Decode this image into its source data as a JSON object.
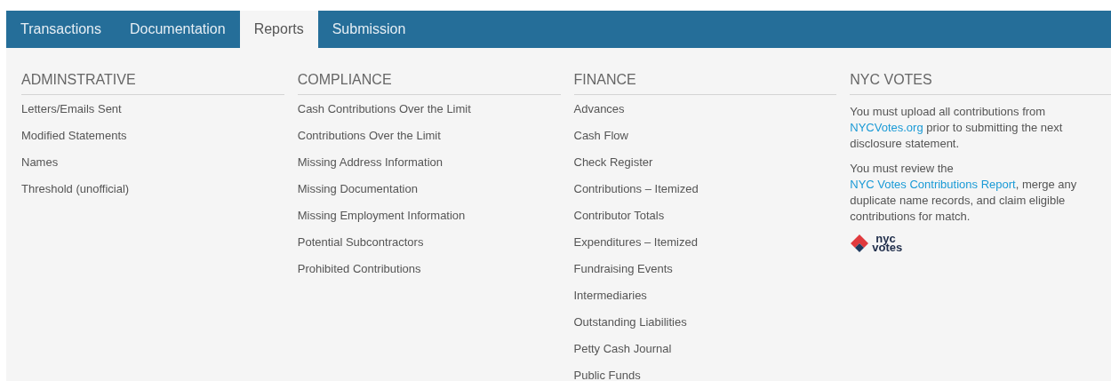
{
  "tabs": [
    {
      "label": "Transactions",
      "selected": false
    },
    {
      "label": "Documentation",
      "selected": false
    },
    {
      "label": "Reports",
      "selected": true
    },
    {
      "label": "Submission",
      "selected": false
    }
  ],
  "columns": [
    {
      "heading": "ADMINSTRATIVE",
      "items": [
        "Letters/Emails Sent",
        "Modified Statements",
        "Names",
        "Threshold (unofficial)"
      ]
    },
    {
      "heading": "COMPLIANCE",
      "items": [
        "Cash Contributions Over the Limit",
        "Contributions Over the Limit",
        "Missing Address Information",
        "Missing Documentation",
        "Missing Employment Information",
        "Potential Subcontractors",
        "Prohibited Contributions"
      ]
    },
    {
      "heading": "FINANCE",
      "items": [
        "Advances",
        "Cash Flow",
        "Check Register",
        "Contributions – Itemized",
        "Contributor Totals",
        "Expenditures – Itemized",
        "Fundraising Events",
        "Intermediaries",
        "Outstanding Liabilities",
        "Petty Cash Journal",
        "Public Funds"
      ]
    }
  ],
  "nyc_votes": {
    "heading": "NYC VOTES",
    "paragraphs": [
      [
        {
          "text": "You must upload all contributions from ",
          "link": false
        },
        {
          "text": "NYCVotes.org",
          "link": true
        },
        {
          "text": " prior to submitting the next disclosure statement.",
          "link": false
        }
      ],
      [
        {
          "text": "You must review the ",
          "link": false
        },
        {
          "text": "NYC Votes Contributions Report",
          "link": true
        },
        {
          "text": ", merge any duplicate name records, and claim eligible contributions for match.",
          "link": false
        }
      ]
    ],
    "logo": {
      "line_1": "nyc",
      "line_2": "votes"
    }
  }
}
